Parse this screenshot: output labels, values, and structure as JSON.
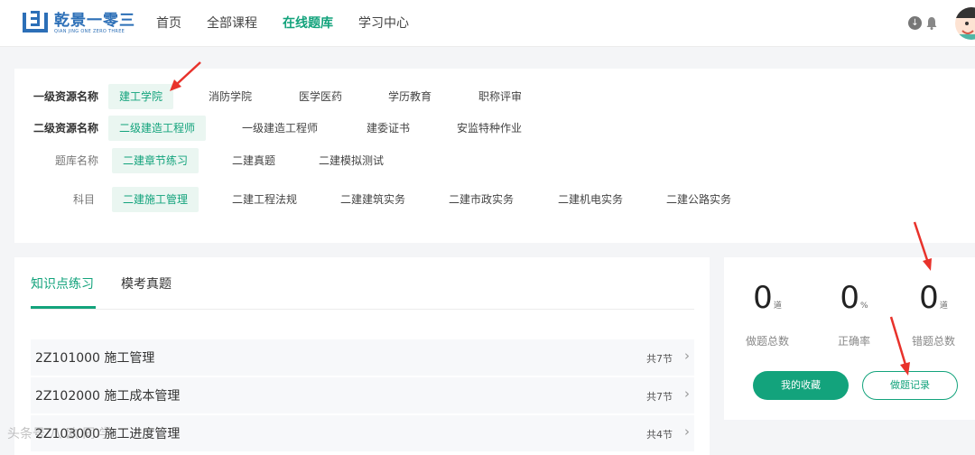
{
  "brand": {
    "name": "乾景一零三",
    "subtitle": "QIAN JING ONE ZERO THREE",
    "color": "#2c6fb7"
  },
  "nav": {
    "items": [
      {
        "label": "首页",
        "active": false
      },
      {
        "label": "全部课程",
        "active": false
      },
      {
        "label": "在线题库",
        "active": true
      },
      {
        "label": "学习中心",
        "active": false
      }
    ]
  },
  "header": {
    "download_icon": "download-circle-icon",
    "bell_icon": "bell-icon"
  },
  "filters": {
    "level1": {
      "label": "一级资源名称",
      "options": [
        "建工学院",
        "消防学院",
        "医学医药",
        "学历教育",
        "职称评审"
      ],
      "selected": "建工学院"
    },
    "level2": {
      "label": "二级资源名称",
      "options": [
        "二级建造工程师",
        "一级建造工程师",
        "建委证书",
        "安监特种作业"
      ],
      "selected": "二级建造工程师"
    },
    "bank": {
      "label": "题库名称",
      "options": [
        "二建章节练习",
        "二建真题",
        "二建模拟测试"
      ],
      "selected": "二建章节练习"
    },
    "subject": {
      "label": "科目",
      "options": [
        "二建施工管理",
        "二建工程法规",
        "二建建筑实务",
        "二建市政实务",
        "二建机电实务",
        "二建公路实务"
      ],
      "selected": "二建施工管理"
    }
  },
  "practice": {
    "tabs": [
      {
        "label": "知识点练习",
        "active": true
      },
      {
        "label": "模考真题",
        "active": false
      }
    ],
    "chapters": [
      {
        "title": "2Z101000 施工管理",
        "count": "共7节"
      },
      {
        "title": "2Z102000 施工成本管理",
        "count": "共7节"
      },
      {
        "title": "2Z103000 施工进度管理",
        "count": "共4节"
      }
    ]
  },
  "stats": {
    "items": [
      {
        "value": "0",
        "unit": "道",
        "label": "做题总数"
      },
      {
        "value": "0",
        "unit": "%",
        "label": "正确率"
      },
      {
        "value": "0",
        "unit": "道",
        "label": "错题总数"
      }
    ],
    "favorites_label": "我的收藏",
    "records_label": "做题记录"
  },
  "watermark": "头条号 八 欧 同 学",
  "colors": {
    "accent": "#13a37c",
    "selected_bg": "#eaf6f1",
    "annotation": "#e8322b"
  }
}
